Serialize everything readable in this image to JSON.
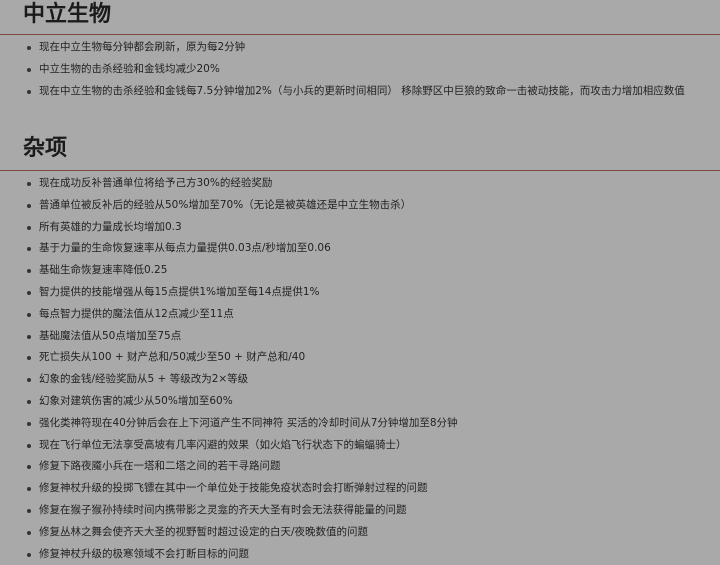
{
  "neutral": {
    "title": "中立生物",
    "items": [
      "现在中立生物每分钟都会刷新，原为每2分钟",
      "中立生物的击杀经验和金钱均减少20%",
      "现在中立生物的击杀经验和金钱每7.5分钟增加2%（与小兵的更新时间相同） 移除野区中巨狼的致命一击被动技能，而攻击力增加相应数值"
    ]
  },
  "misc": {
    "title": "杂项",
    "items": [
      "现在成功反补普通单位将给予己方30%的经验奖励",
      "普通单位被反补后的经验从50%增加至70%（无论是被英雄还是中立生物击杀）",
      "所有英雄的力量成长均增加0.3",
      "基于力量的生命恢复速率从每点力量提供0.03点/秒增加至0.06",
      "基础生命恢复速率降低0.25",
      "智力提供的技能增强从每15点提供1%增加至每14点提供1%",
      "每点智力提供的魔法值从12点减少至11点",
      "基础魔法值从50点增加至75点",
      "死亡损失从100 + 财产总和/50减少至50 + 财产总和/40",
      "幻象的金钱/经验奖励从5 + 等级改为2×等级",
      "幻象对建筑伤害的减少从50%增加至60%",
      "强化类神符现在40分钟后会在上下河道产生不同神符 买活的冷却时间从7分钟增加至8分钟",
      "现在飞行单位无法享受高坡有几率闪避的效果（如火焰飞行状态下的蝙蝠骑士）",
      "修复下路夜魇小兵在一塔和二塔之间的若干寻路问题",
      "修复神杖升级的投掷飞镖在其中一个单位处于技能免疫状态时会打断弹射过程的问题",
      "修复在猴子猴孙持续时间内携带影之灵龛的齐天大圣有时会无法获得能量的问题",
      "修复丛林之舞会使齐天大圣的视野暂时超过设定的白天/夜晚数值的问题",
      "修复神杖升级的极寒领域不会打断目标的问题"
    ]
  }
}
